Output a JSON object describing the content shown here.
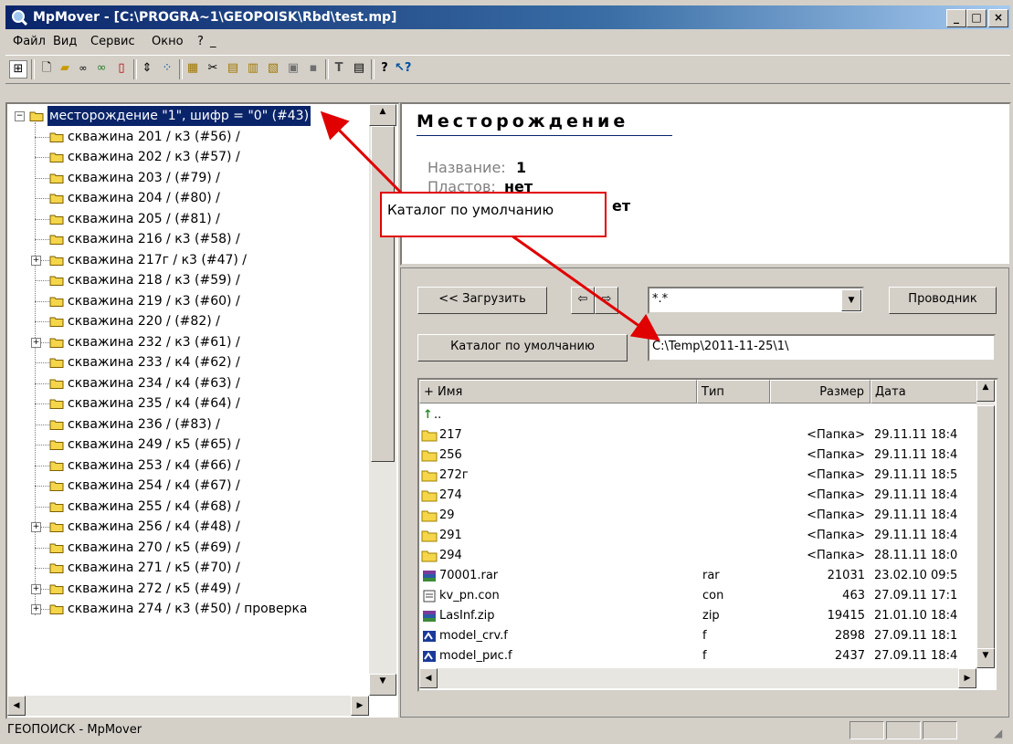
{
  "window": {
    "title": "MpMover - [C:\\PROGRA~1\\GEOPOISK\\Rbd\\test.mp]",
    "minimize": "_",
    "maximize": "□",
    "close": "×"
  },
  "menu": [
    "Файл",
    "Вид",
    "Сервис",
    "Окно",
    "?",
    "_"
  ],
  "tree": {
    "root": "месторождение \"1\", шифр = \"0\" (#43)",
    "items": [
      {
        "label": "скважина 201 / к3 (#56) /",
        "expandable": false
      },
      {
        "label": "скважина 202 / к3 (#57) /",
        "expandable": false
      },
      {
        "label": "скважина 203 /   (#79) /",
        "expandable": false
      },
      {
        "label": "скважина 204 /   (#80) /",
        "expandable": false
      },
      {
        "label": "скважина 205 /   (#81) /",
        "expandable": false
      },
      {
        "label": "скважина 216 / к3 (#58) /",
        "expandable": false
      },
      {
        "label": "скважина 217г / к3 (#47) /",
        "expandable": true
      },
      {
        "label": "скважина 218 / к3 (#59) /",
        "expandable": false
      },
      {
        "label": "скважина 219 / к3 (#60) /",
        "expandable": false
      },
      {
        "label": "скважина 220 /   (#82) /",
        "expandable": false
      },
      {
        "label": "скважина 232 / к3 (#61) /",
        "expandable": true
      },
      {
        "label": "скважина 233 / к4 (#62) /",
        "expandable": false
      },
      {
        "label": "скважина 234 / к4 (#63) /",
        "expandable": false
      },
      {
        "label": "скважина 235 / к4 (#64) /",
        "expandable": false
      },
      {
        "label": "скважина 236 /   (#83) /",
        "expandable": false
      },
      {
        "label": "скважина 249 / к5 (#65) /",
        "expandable": false
      },
      {
        "label": "скважина 253 / к4 (#66) /",
        "expandable": false
      },
      {
        "label": "скважина 254 / к4 (#67) /",
        "expandable": false
      },
      {
        "label": "скважина 255 / к4 (#68) /",
        "expandable": false
      },
      {
        "label": "скважина 256 / к4 (#48) /",
        "expandable": true
      },
      {
        "label": "скважина 270 / к5 (#69) /",
        "expandable": false
      },
      {
        "label": "скважина 271 / к5 (#70) /",
        "expandable": false
      },
      {
        "label": "скважина 272 / к5 (#49) /",
        "expandable": true
      },
      {
        "label": "скважина 274 / к3 (#50) / проверка",
        "expandable": true
      }
    ]
  },
  "info": {
    "heading": "Месторождение",
    "name_label": "Название:",
    "name_value": "1",
    "layers_label": "Пластов:",
    "layers_value": "нет",
    "third_value": "ет"
  },
  "filepanel": {
    "load_button": "<< Загрузить",
    "back": "⇦",
    "forward": "⇨",
    "mask": "*.*",
    "explorer_button": "Проводник",
    "default_dir_button": "Каталог по умолчанию",
    "path": "C:\\Temp\\2011-11-25\\1\\",
    "columns": [
      "+ Имя",
      "Тип",
      "Размер",
      "Дата"
    ],
    "up": "..",
    "files": [
      {
        "name": "217",
        "type": "",
        "size": "<Папка>",
        "date": "29.11.11 18:4",
        "icon": "folder"
      },
      {
        "name": "256",
        "type": "",
        "size": "<Папка>",
        "date": "29.11.11 18:4",
        "icon": "folder"
      },
      {
        "name": "272г",
        "type": "",
        "size": "<Папка>",
        "date": "29.11.11 18:5",
        "icon": "folder"
      },
      {
        "name": "274",
        "type": "",
        "size": "<Папка>",
        "date": "29.11.11 18:4",
        "icon": "folder"
      },
      {
        "name": "29",
        "type": "",
        "size": "<Папка>",
        "date": "29.11.11 18:4",
        "icon": "folder"
      },
      {
        "name": "291",
        "type": "",
        "size": "<Папка>",
        "date": "29.11.11 18:4",
        "icon": "folder"
      },
      {
        "name": "294",
        "type": "",
        "size": "<Папка>",
        "date": "28.11.11 18:0",
        "icon": "folder"
      },
      {
        "name": "70001.rar",
        "type": "rar",
        "size": "21031",
        "date": "23.02.10 09:5",
        "icon": "archive"
      },
      {
        "name": "kv_pn.con",
        "type": "con",
        "size": "463",
        "date": "27.09.11 17:1",
        "icon": "file"
      },
      {
        "name": "LasInf.zip",
        "type": "zip",
        "size": "19415",
        "date": "21.01.10 18:4",
        "icon": "archive"
      },
      {
        "name": "model_crv.f",
        "type": "f",
        "size": "2898",
        "date": "27.09.11 18:1",
        "icon": "program"
      },
      {
        "name": "model_рис.f",
        "type": "f",
        "size": "2437",
        "date": "27.09.11 18:4",
        "icon": "program"
      }
    ]
  },
  "annotation": {
    "text": "Каталог по умолчанию",
    "color": "#e00000"
  },
  "status": {
    "text": "ГЕОПОИСК - MpMover"
  },
  "colors": {
    "selection": "#0a246a",
    "folder": "#f5d54a",
    "arrow": "#e00000"
  }
}
